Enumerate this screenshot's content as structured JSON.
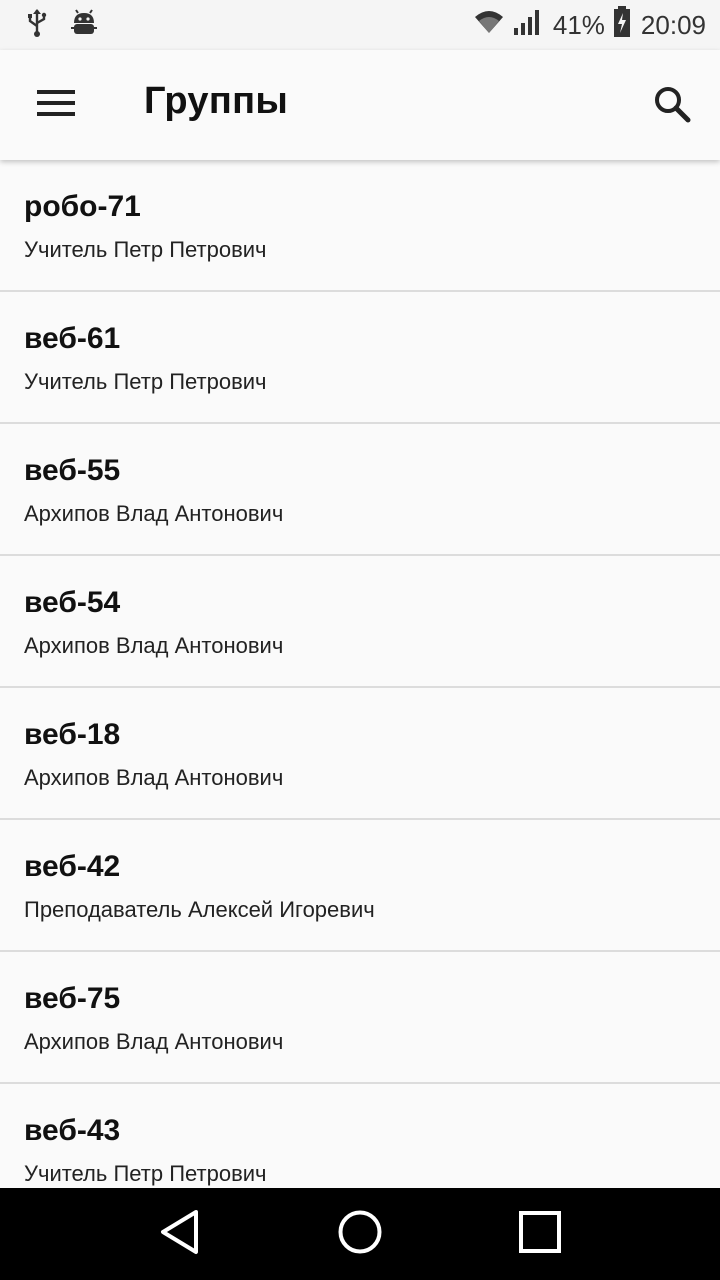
{
  "status_bar": {
    "battery_percent": "41%",
    "time": "20:09",
    "icons": [
      "usb-icon",
      "android-debug-icon",
      "wifi-icon",
      "signal-icon",
      "battery-charging-icon"
    ]
  },
  "app_bar": {
    "title": "Группы",
    "menu_icon": "menu-icon",
    "search_icon": "search-icon"
  },
  "groups": [
    {
      "name": "робо-71",
      "teacher": "Учитель Петр Петрович"
    },
    {
      "name": "веб-61",
      "teacher": "Учитель Петр Петрович"
    },
    {
      "name": "веб-55",
      "teacher": "Архипов Влад Антонович"
    },
    {
      "name": "веб-54",
      "teacher": "Архипов Влад Антонович"
    },
    {
      "name": "веб-18",
      "teacher": "Архипов Влад Антонович"
    },
    {
      "name": "веб-42",
      "teacher": "Преподаватель Алексей Игоревич"
    },
    {
      "name": "веб-75",
      "teacher": "Архипов Влад Антонович"
    },
    {
      "name": "веб-43",
      "teacher": "Учитель Петр Петрович"
    }
  ],
  "nav_bar": {
    "icons": [
      "back-icon",
      "home-icon",
      "recents-icon"
    ]
  }
}
